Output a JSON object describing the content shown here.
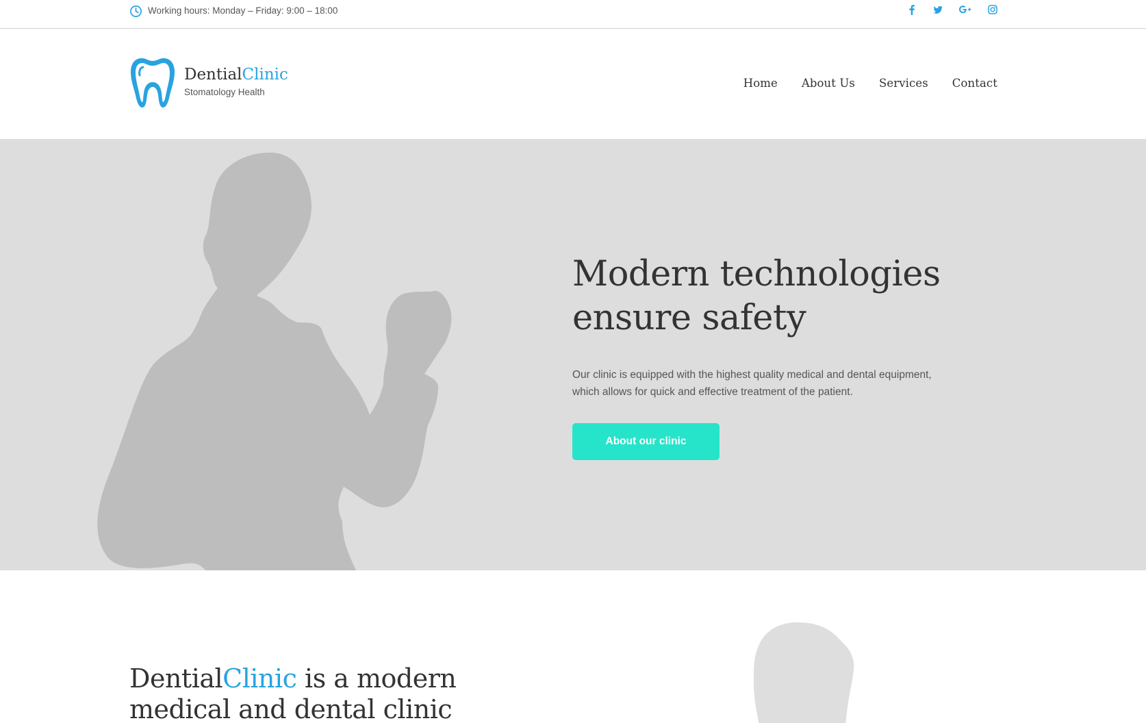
{
  "topbar": {
    "hours_icon": "clock-icon",
    "hours_text": "Working hours: Monday – Friday: 9:00 – 18:00",
    "socials": [
      {
        "name": "facebook-icon"
      },
      {
        "name": "twitter-icon"
      },
      {
        "name": "google-plus-icon"
      },
      {
        "name": "instagram-icon"
      }
    ]
  },
  "header": {
    "logo_icon": "tooth-icon",
    "brand_part1": "Dential",
    "brand_part2": "Clinic",
    "brand_sub": "Stomatology Health",
    "nav": [
      "Home",
      "About Us",
      "Services",
      "Contact"
    ]
  },
  "hero": {
    "title_line1": "Modern technologies",
    "title_line2": "ensure safety",
    "text": "Our clinic is equipped with the highest quality medical and dental equipment, which allows for quick and effective treatment of the patient.",
    "button_label": "About our clinic"
  },
  "about": {
    "title_part1": "Dential",
    "title_part2": "Clinic",
    "title_part3": " is a modern medical and dental clinic"
  },
  "colors": {
    "accent_blue": "#29a3e0",
    "button_teal": "#26e4c9",
    "hero_bg": "#dddddd",
    "silhouette": "#bdbdbd"
  }
}
